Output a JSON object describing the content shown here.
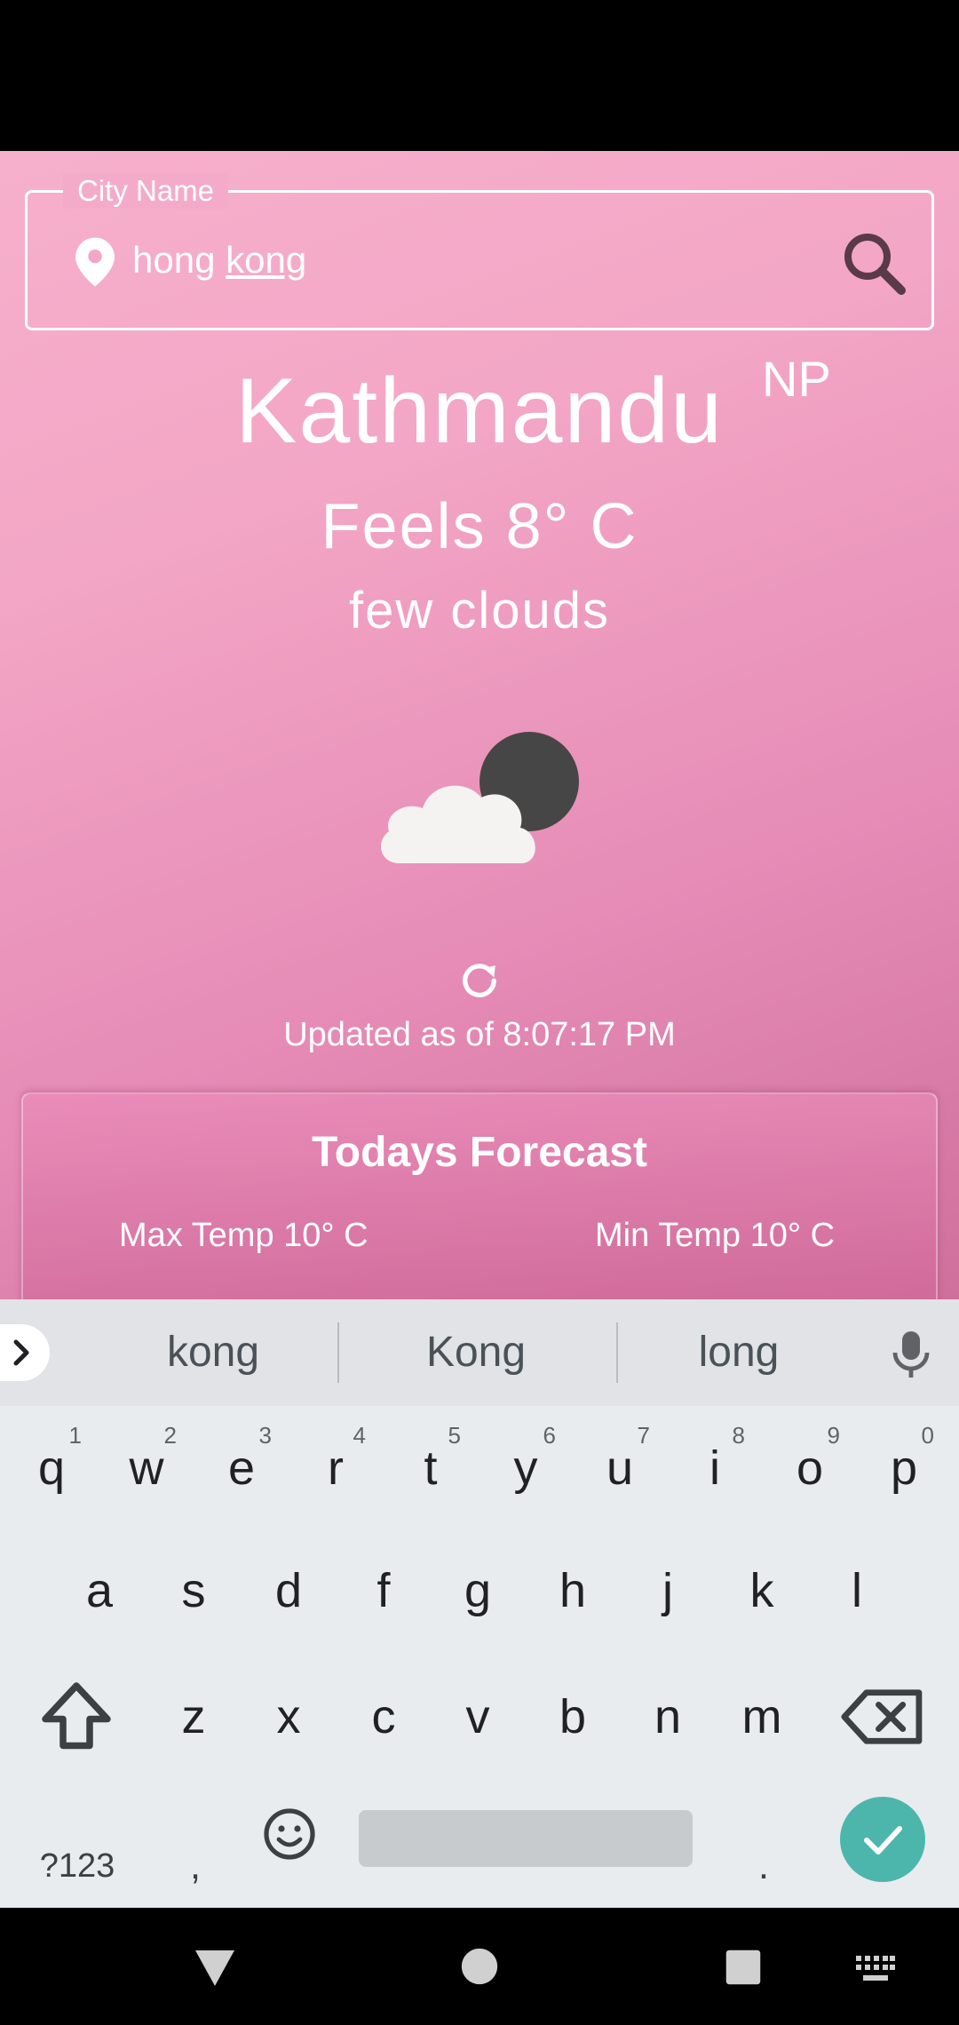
{
  "search": {
    "label": "City Name",
    "value_part1": "hong ",
    "value_part2": "kong"
  },
  "weather": {
    "city": "Kathmandu",
    "country": "NP",
    "feels": "Feels 8° C",
    "description": "few clouds",
    "icon": "cloud-moon-icon",
    "updated": "Updated as of 8:07:17 PM"
  },
  "forecast": {
    "title": "Todays Forecast",
    "max": "Max Temp 10° C",
    "min": "Min Temp 10° C"
  },
  "keyboard": {
    "suggestions": [
      "kong",
      "Kong",
      "long"
    ],
    "row1": [
      {
        "k": "q",
        "h": "1"
      },
      {
        "k": "w",
        "h": "2"
      },
      {
        "k": "e",
        "h": "3"
      },
      {
        "k": "r",
        "h": "4"
      },
      {
        "k": "t",
        "h": "5"
      },
      {
        "k": "y",
        "h": "6"
      },
      {
        "k": "u",
        "h": "7"
      },
      {
        "k": "i",
        "h": "8"
      },
      {
        "k": "o",
        "h": "9"
      },
      {
        "k": "p",
        "h": "0"
      }
    ],
    "row2": [
      "a",
      "s",
      "d",
      "f",
      "g",
      "h",
      "j",
      "k",
      "l"
    ],
    "row3": [
      "z",
      "x",
      "c",
      "v",
      "b",
      "n",
      "m"
    ],
    "symbols": "?123",
    "comma": ",",
    "period": "."
  },
  "colors": {
    "background_top": "#f6b0cc",
    "background_bottom": "#cf6f9c",
    "enter_key": "#4db6ac"
  }
}
